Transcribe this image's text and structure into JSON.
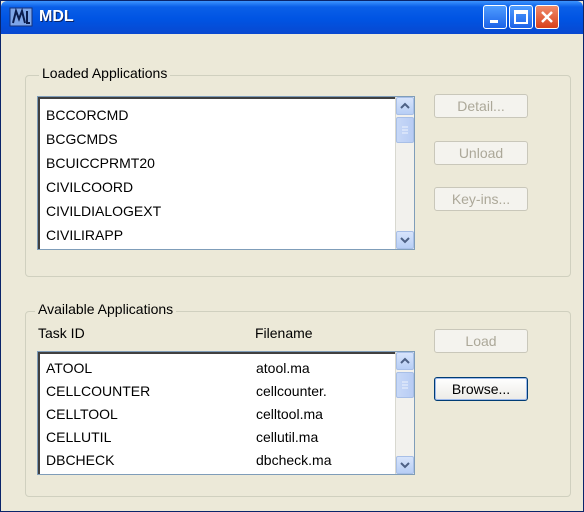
{
  "window": {
    "title": "MDL"
  },
  "loaded": {
    "label": "Loaded Applications",
    "items": [
      "BCCORCMD",
      "BCGCMDS",
      "BCUICCPRMT20",
      "CIVILCOORD",
      "CIVILDIALOGEXT",
      "CIVILIRAPP"
    ],
    "buttons": {
      "detail": "Detail...",
      "unload": "Unload",
      "keyins": "Key-ins..."
    }
  },
  "available": {
    "label": "Available Applications",
    "col_task": "Task ID",
    "col_file": "Filename",
    "rows": [
      {
        "task": "ATOOL",
        "file": "atool.ma"
      },
      {
        "task": "CELLCOUNTER",
        "file": "cellcounter."
      },
      {
        "task": "CELLTOOL",
        "file": "celltool.ma"
      },
      {
        "task": "CELLUTIL",
        "file": "cellutil.ma"
      },
      {
        "task": "DBCHECK",
        "file": "dbcheck.ma"
      }
    ],
    "buttons": {
      "load": "Load",
      "browse": "Browse..."
    }
  }
}
